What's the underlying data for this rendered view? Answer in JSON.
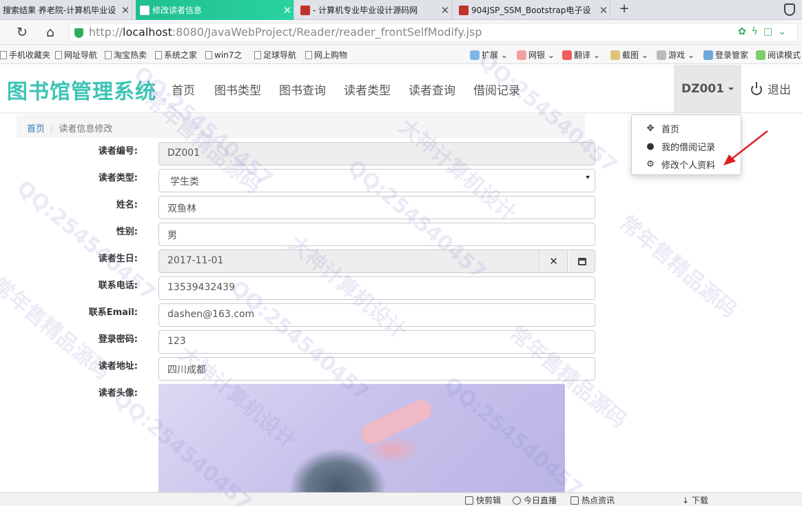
{
  "browser": {
    "tabs": [
      {
        "title": "搜索结果 养老院-计算机毕业设"
      },
      {
        "title": "修改读者信息"
      },
      {
        "title": "- 计算机专业毕业设计源码网"
      },
      {
        "title": "904JSP_SSM_Bootstrap电子设"
      }
    ],
    "new_tab": "+",
    "url_prefix": "http://",
    "url_host": "localhost",
    "url_path": ":8080/JavaWebProject/Reader/reader_frontSelfModify.jsp",
    "bookmarks": [
      "手机收藏夹",
      "网址导航",
      "淘宝热卖",
      "系统之家",
      "win7之",
      "足球导航",
      "网上购物"
    ],
    "extensions": [
      "扩展",
      "网银",
      "翻译",
      "截图",
      "游戏",
      "登录管家",
      "阅读模式"
    ]
  },
  "app": {
    "brand": "图书馆管理系统",
    "nav": [
      "首页",
      "图书类型",
      "图书查询",
      "读者类型",
      "读者查询",
      "借阅记录"
    ],
    "user": "DZ001",
    "logout": "退出",
    "dropdown": [
      "首页",
      "我的借阅记录",
      "修改个人资料"
    ]
  },
  "breadcrumb": {
    "home": "首页",
    "sep": "/",
    "current": "读者信息修改"
  },
  "form": {
    "reader_no_label": "读者编号:",
    "reader_no": "DZ001",
    "reader_type_label": "读者类型:",
    "reader_type": "学生类",
    "name_label": "姓名:",
    "name": "双鱼林",
    "sex_label": "性别:",
    "sex": "男",
    "birthday_label": "读者生日:",
    "birthday": "2017-11-01",
    "phone_label": "联系电话:",
    "phone": "13539432439",
    "email_label": "联系Email:",
    "email": "dashen@163.com",
    "password_label": "登录密码:",
    "password": "123",
    "address_label": "读者地址:",
    "address": "四川成都",
    "photo_label": "读者头像:"
  },
  "statusbar": [
    "快剪辑",
    "今日直播",
    "热点资讯",
    "下载"
  ],
  "watermarks": [
    "QQ:254540457",
    "大神计算机设计",
    "常年售精品源码"
  ],
  "colors": {
    "brand": "#3cc4b4",
    "active_tab": "#20c997",
    "link": "#337ab7"
  }
}
